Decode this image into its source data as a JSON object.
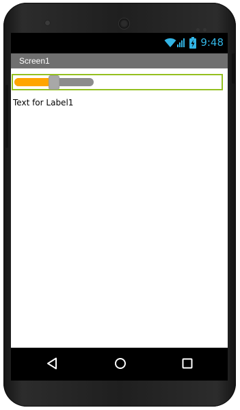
{
  "statusbar": {
    "time": "9:48",
    "icons": [
      "wifi-icon",
      "signal-icon",
      "battery-charging-icon"
    ]
  },
  "titlebar": {
    "title": "Screen1"
  },
  "slider": {
    "value_fraction": 0.5
  },
  "label1": {
    "text": "Text for Label1"
  },
  "navbar": {
    "buttons": [
      "back-icon",
      "home-icon",
      "recents-icon"
    ]
  },
  "colors": {
    "accent": "#33b5e5",
    "slider_fill": "#ffa500",
    "slider_border": "#94c01f",
    "titlebar": "#6f6f6f"
  }
}
